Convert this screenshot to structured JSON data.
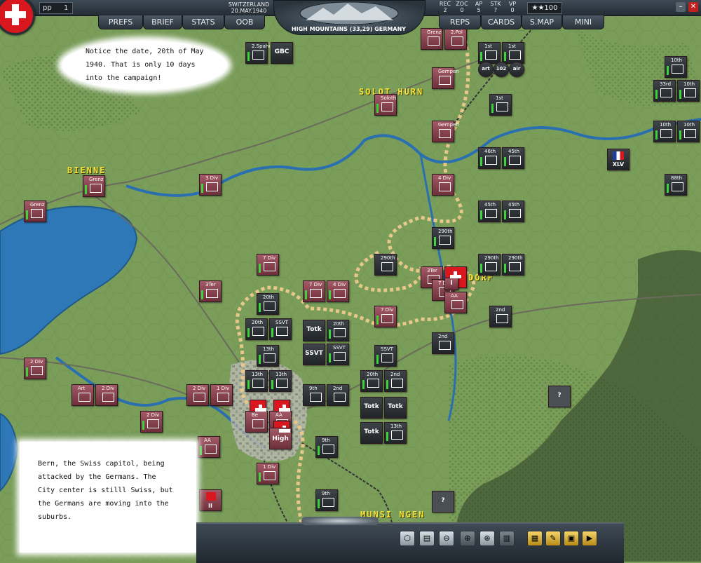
{
  "top_bar": {
    "pp_label": "pp",
    "pp_value": "1",
    "country": "SWITZERLAND",
    "date": "20.MAY.1940",
    "terrain_info": "HIGH MOUNTAINS (33,29) GERMANY",
    "stats": [
      {
        "label": "REC",
        "value": "2"
      },
      {
        "label": "ZOC",
        "value": "0"
      },
      {
        "label": "AP",
        "value": "5"
      },
      {
        "label": "STK",
        "value": "?"
      },
      {
        "label": "VP",
        "value": "0"
      }
    ],
    "stars": "★★100"
  },
  "menu_left": [
    "PREFS",
    "BRIEF",
    "STATS",
    "OOB"
  ],
  "menu_right": [
    "REPS",
    "CARDS",
    "S.MAP",
    "MINI"
  ],
  "callouts": {
    "top": "Notice the date, 20th of May 1940. That is only 10 days into the campaign!",
    "bottom": "Bern, the Swiss capitol, being attacked by the Germans. The City center is stilll Swiss, but the Germans are moving into the suburbs."
  },
  "cities": {
    "solothurn": "SOLOT HURN",
    "bienne": "BIENNE",
    "dorf": "DORF",
    "munsingen": "MUNSI NGEN"
  },
  "colors": {
    "swiss_red": "#d8181e",
    "axis_counter": "#2b3136",
    "swiss_counter": "#8a4550",
    "lake": "#2f78b8",
    "grass": "#7a9d5a",
    "encirclement": "#e8c88a"
  },
  "units": {
    "u1": "2.Spahi",
    "u2": "GBC",
    "u3": "Grenz",
    "u4": "2.Pol",
    "u5": "1st",
    "u6": "1st",
    "u7": "art",
    "u8": "102",
    "u9": "air",
    "u10": "10th",
    "u11": "33rd",
    "u12": "10th",
    "u13": "Soloth",
    "u14": "Gempen",
    "u15": "Gempen",
    "u16": "1st",
    "u17": "10th",
    "u18": "10th",
    "u19": "46th",
    "u20": "45th",
    "u21": "XLV",
    "u22": "Grenz",
    "u23": "3 Div",
    "u24": "4 Div",
    "u25": "88th",
    "u26": "Grenz",
    "u27": "45th",
    "u28": "45th",
    "u29": "290th",
    "u30": "7 Div",
    "u31": "290th",
    "u32": "3Ter",
    "u33": "290th",
    "u34": "290th",
    "u35": "3Ter",
    "u36": "7 Div",
    "u37": "4 Div",
    "u38": "7 Div",
    "u39": "20th",
    "u40": "2nd",
    "u41": "7 Div",
    "u42": "20th",
    "u43": "SSVT",
    "u44": "Totk",
    "u45": "20th",
    "u46": "2nd",
    "u47": "Totk",
    "u48": "SSVT",
    "u49": "SSVT",
    "u50": "13th",
    "u51": "SSVT",
    "u52": "2 Div",
    "u53": "13th",
    "u54": "13th",
    "u55": "9th",
    "u56": "2nd",
    "u57": "20th",
    "u58": "2nd",
    "u59": "Art",
    "u60": "2 Div",
    "u61": "2 Div",
    "u62": "1 Div",
    "u63": "Be",
    "u64": "AA",
    "u65": "Totk",
    "u66": "Totk",
    "u67": "2 Div",
    "u68": "AA",
    "u69": "High",
    "u70": "9th",
    "u71": "Totk",
    "u72": "13th",
    "u73": "?",
    "u74": "1 Div",
    "u75": "9th",
    "u76": "?",
    "u77": "II",
    "u78": "AA",
    "u79": "I"
  }
}
